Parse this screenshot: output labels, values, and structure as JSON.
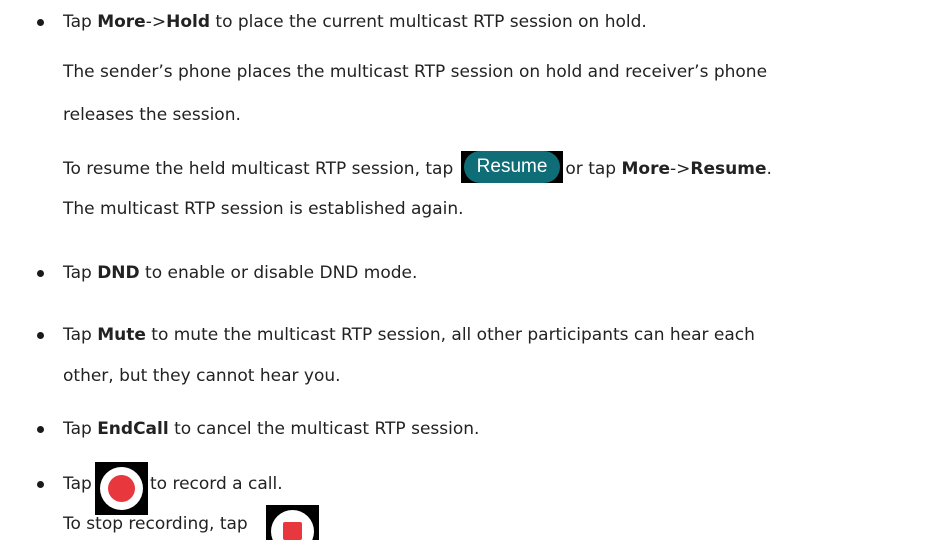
{
  "items": {
    "hold": {
      "pre": "Tap ",
      "more": "More",
      "arrow": "->",
      "hold": "Hold",
      "post": " to place the current multicast RTP session on hold."
    },
    "hold_desc_1": "The sender’s phone places the multicast RTP session on hold and receiver’s phone",
    "hold_desc_2": "releases the session.",
    "resume": {
      "pre": "To resume the held multicast RTP session, tap ",
      "button_label": "Resume",
      "mid": "or tap ",
      "more": "More",
      "arrow": "->",
      "resume": "Resume",
      "post": "."
    },
    "resume_desc": "The multicast RTP session is established again.",
    "dnd": {
      "pre": "Tap ",
      "bold": "DND",
      "post": " to enable or disable DND mode."
    },
    "mute": {
      "pre": "Tap ",
      "bold": "Mute",
      "post": " to mute the multicast RTP session, all other participants can hear each",
      "line2": "other, but they cannot hear you."
    },
    "endcall": {
      "pre": "Tap ",
      "bold": "EndCall",
      "post": " to cancel the multicast RTP session."
    },
    "record": {
      "pre": "Tap",
      "post": "to record a call.",
      "stop": "To stop recording, tap"
    }
  },
  "colors": {
    "text": "#222222",
    "resume_button": "#0e6d76",
    "record_red": "#e8383d"
  },
  "icons": {
    "record": "record-icon",
    "stop": "stop-recording-icon"
  }
}
